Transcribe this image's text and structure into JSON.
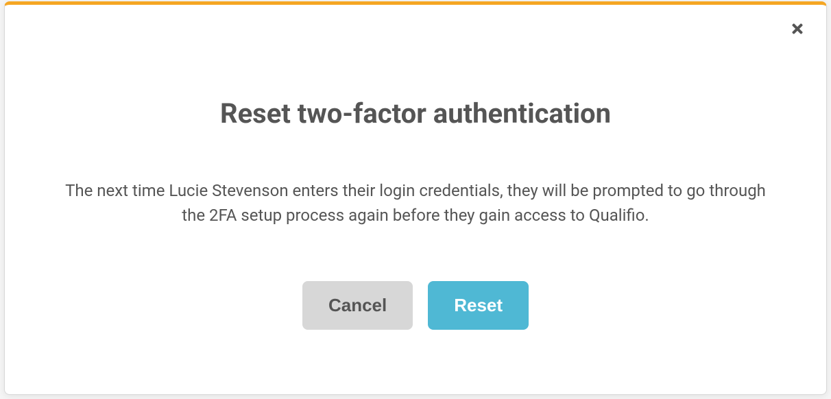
{
  "modal": {
    "title": "Reset two-factor authentication",
    "body": "The next time Lucie Stevenson enters their login credentials, they will be prompted to go through the 2FA setup process again before they gain access to Qualifio.",
    "cancel_label": "Cancel",
    "reset_label": "Reset"
  }
}
